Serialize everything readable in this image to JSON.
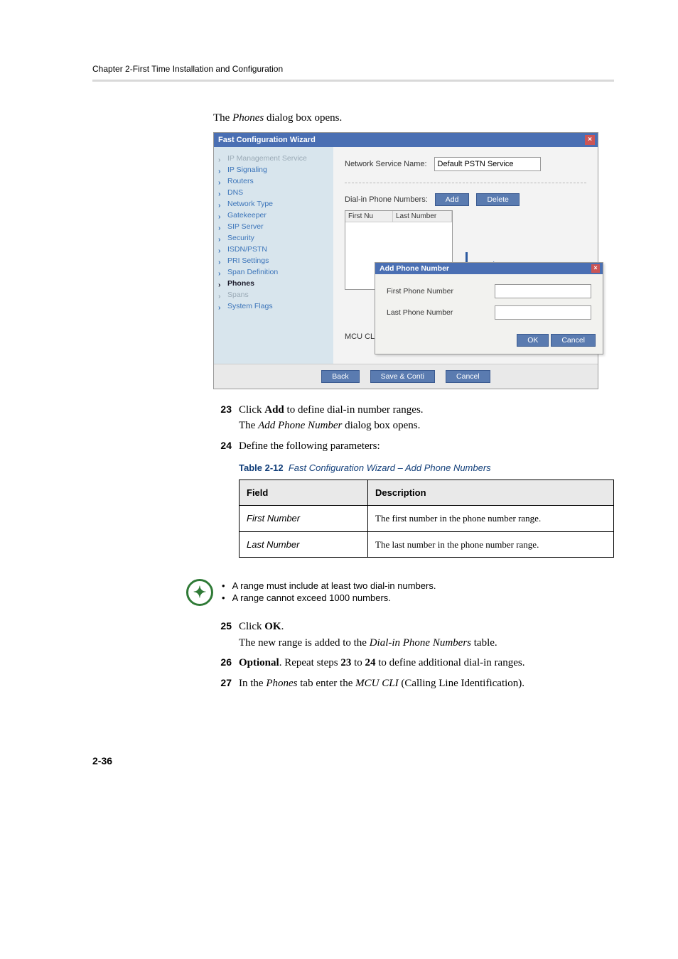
{
  "header": {
    "chapter_line": "Chapter 2-First Time Installation and Configuration"
  },
  "intro_line": "The Phones dialog box opens.",
  "intro_prefix": "The ",
  "intro_em": "Phones",
  "intro_suffix": " dialog box opens.",
  "shot": {
    "window_title": "Fast Configuration Wizard",
    "close_glyph": "×",
    "nav": [
      {
        "label": "IP Management Service",
        "state": "muted"
      },
      {
        "label": "IP Signaling",
        "state": "normal"
      },
      {
        "label": "Routers",
        "state": "normal"
      },
      {
        "label": "DNS",
        "state": "normal"
      },
      {
        "label": "Network Type",
        "state": "normal"
      },
      {
        "label": "Gatekeeper",
        "state": "normal"
      },
      {
        "label": "SIP Server",
        "state": "normal"
      },
      {
        "label": "Security",
        "state": "normal"
      },
      {
        "label": "ISDN/PSTN",
        "state": "normal"
      },
      {
        "label": "PRI Settings",
        "state": "normal"
      },
      {
        "label": "Span Definition",
        "state": "normal"
      },
      {
        "label": "Phones",
        "state": "current"
      },
      {
        "label": "Spans",
        "state": "muted"
      },
      {
        "label": "System Flags",
        "state": "normal"
      }
    ],
    "service_name_label": "Network Service Name:",
    "service_name_value": "Default PSTN Service",
    "dialin_label": "Dial-in Phone Numbers:",
    "add_btn": "Add",
    "delete_btn": "Delete",
    "col_first": "First Nu",
    "col_last": "Last Number",
    "mcu_cli_label": "MCU CLI:",
    "popup": {
      "title": "Add Phone Number",
      "first_label": "First Phone Number",
      "last_label": "Last Phone Number",
      "ok": "OK",
      "cancel": "Cancel"
    },
    "footer": {
      "back": "Back",
      "save": "Save & Conti",
      "cancel": "Cancel"
    }
  },
  "steps": {
    "s23": {
      "num": "23",
      "line1_prefix": "Click ",
      "line1_bold": "Add",
      "line1_suffix": " to define dial-in number ranges.",
      "line2_prefix": "The ",
      "line2_em": "Add Phone Number",
      "line2_suffix": " dialog box opens."
    },
    "s24": {
      "num": "24",
      "text": "Define the following parameters:"
    },
    "s25": {
      "num": "25",
      "line1_prefix": "Click ",
      "line1_bold": "OK",
      "line1_suffix": ".",
      "line2_prefix": "The new range is added to the ",
      "line2_em": "Dial-in Phone Numbers",
      "line2_suffix": " table."
    },
    "s26": {
      "num": "26",
      "bold": "Optional",
      "mid1": ". Repeat steps ",
      "b1": "23",
      "mid2": " to ",
      "b2": "24",
      "suffix": " to define additional dial-in ranges."
    },
    "s27": {
      "num": "27",
      "prefix": "In the ",
      "em1": "Phones",
      "mid": " tab enter the ",
      "em2": "MCU CLI",
      "suffix": " (Calling Line Identification)."
    }
  },
  "table": {
    "caption_num": "Table 2-12",
    "caption_text": "Fast Configuration Wizard – Add Phone Numbers",
    "head_field": "Field",
    "head_desc": "Description",
    "rows": [
      {
        "field": "First Number",
        "desc": "The first number in the phone number range."
      },
      {
        "field": "Last Number",
        "desc": "The last number in the phone number range."
      }
    ]
  },
  "notes": [
    "A range must include at least two dial-in numbers.",
    "A range cannot exceed 1000 numbers."
  ],
  "page_number": "2-36"
}
